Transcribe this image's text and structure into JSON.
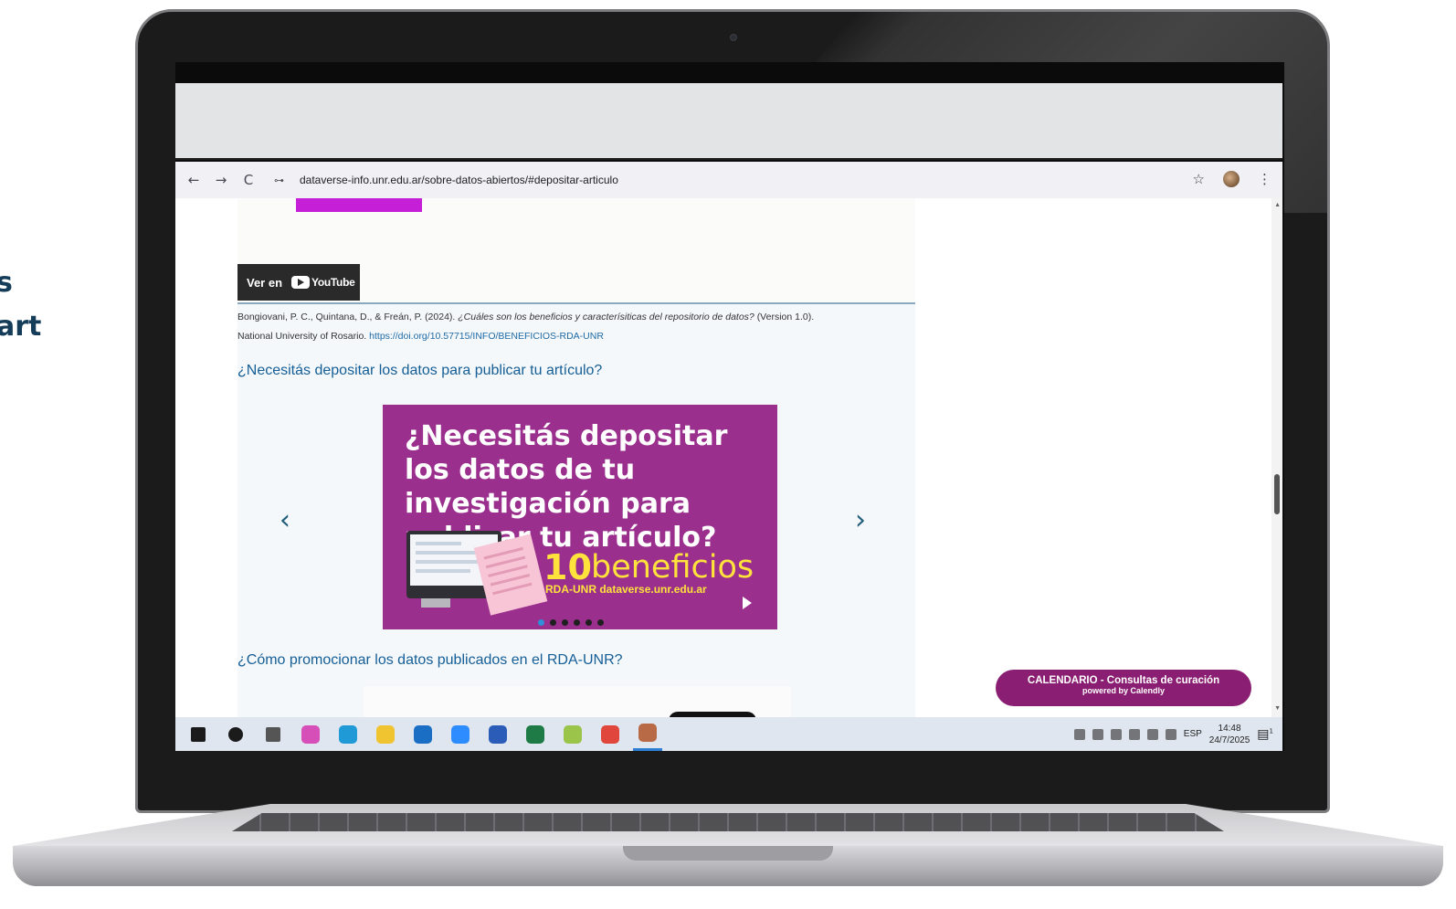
{
  "side_heading": {
    "line1": "s",
    "line2": "art"
  },
  "browser": {
    "url": "dataverse-info.unr.edu.ar/sobre-datos-abiertos/#depositar-articulo",
    "back_icon": "←",
    "forward_icon": "→",
    "reload_icon": "C",
    "star_icon": "☆",
    "menu_icon": "⋮",
    "tune_icon": "⊶"
  },
  "page": {
    "video_button": {
      "prefix": "Ver en",
      "brand": "YouTube"
    },
    "citation": {
      "authors": "Bongiovani, P. C., Quintana, D., & Freán, P. (2024).",
      "title_italic": "¿Cuáles son los beneficios y caracterísiticas del repositorio de datos?",
      "version": "(Version 1.0).",
      "publisher": "National University of Rosario.",
      "doi": "https://doi.org/10.57715/INFO/BENEFICIOS-RDA-UNR"
    },
    "heading_deposit": "¿Necesitás depositar los datos para publicar tu artículo?",
    "heading_promote": "¿Cómo promocionar los datos publicados en el RDA-UNR?",
    "carousel": {
      "prev": "‹",
      "next": "›",
      "banner_title": "¿Necesitás depositar los datos de tu investigación para publicar tu artículo?",
      "number": "10",
      "benefits_word": "beneficios",
      "subtitle": "RDA-UNR dataverse.unr.edu.ar",
      "dots_total": 6,
      "dot_active_index": 0
    }
  },
  "calendly": {
    "title": "CALENDARIO - Consultas de curación",
    "powered": "powered by Calendly"
  },
  "taskbar": {
    "apps": [
      {
        "name": "windows-start-icon",
        "color": "#1b1b1b"
      },
      {
        "name": "search-icon",
        "color": "#1b1b1b"
      },
      {
        "name": "task-view-icon",
        "color": "#555555"
      },
      {
        "name": "copilot-icon",
        "color": "#d64fb8"
      },
      {
        "name": "edge-icon",
        "color": "#1f9ad6"
      },
      {
        "name": "file-explorer-icon",
        "color": "#f0c431"
      },
      {
        "name": "outlook-icon",
        "color": "#1a6fc4"
      },
      {
        "name": "zoom-icon",
        "color": "#2d8cff"
      },
      {
        "name": "word-icon",
        "color": "#2b5cb8"
      },
      {
        "name": "excel-icon",
        "color": "#1e7b45"
      },
      {
        "name": "app-green-icon",
        "color": "#9bc44a"
      },
      {
        "name": "chrome-icon",
        "color": "#e0463b"
      },
      {
        "name": "chrome-profile-icon",
        "color": "#b86a46"
      }
    ],
    "language": "ESP",
    "time": "14:48",
    "date": "24/7/2025",
    "notification_count": "1"
  }
}
